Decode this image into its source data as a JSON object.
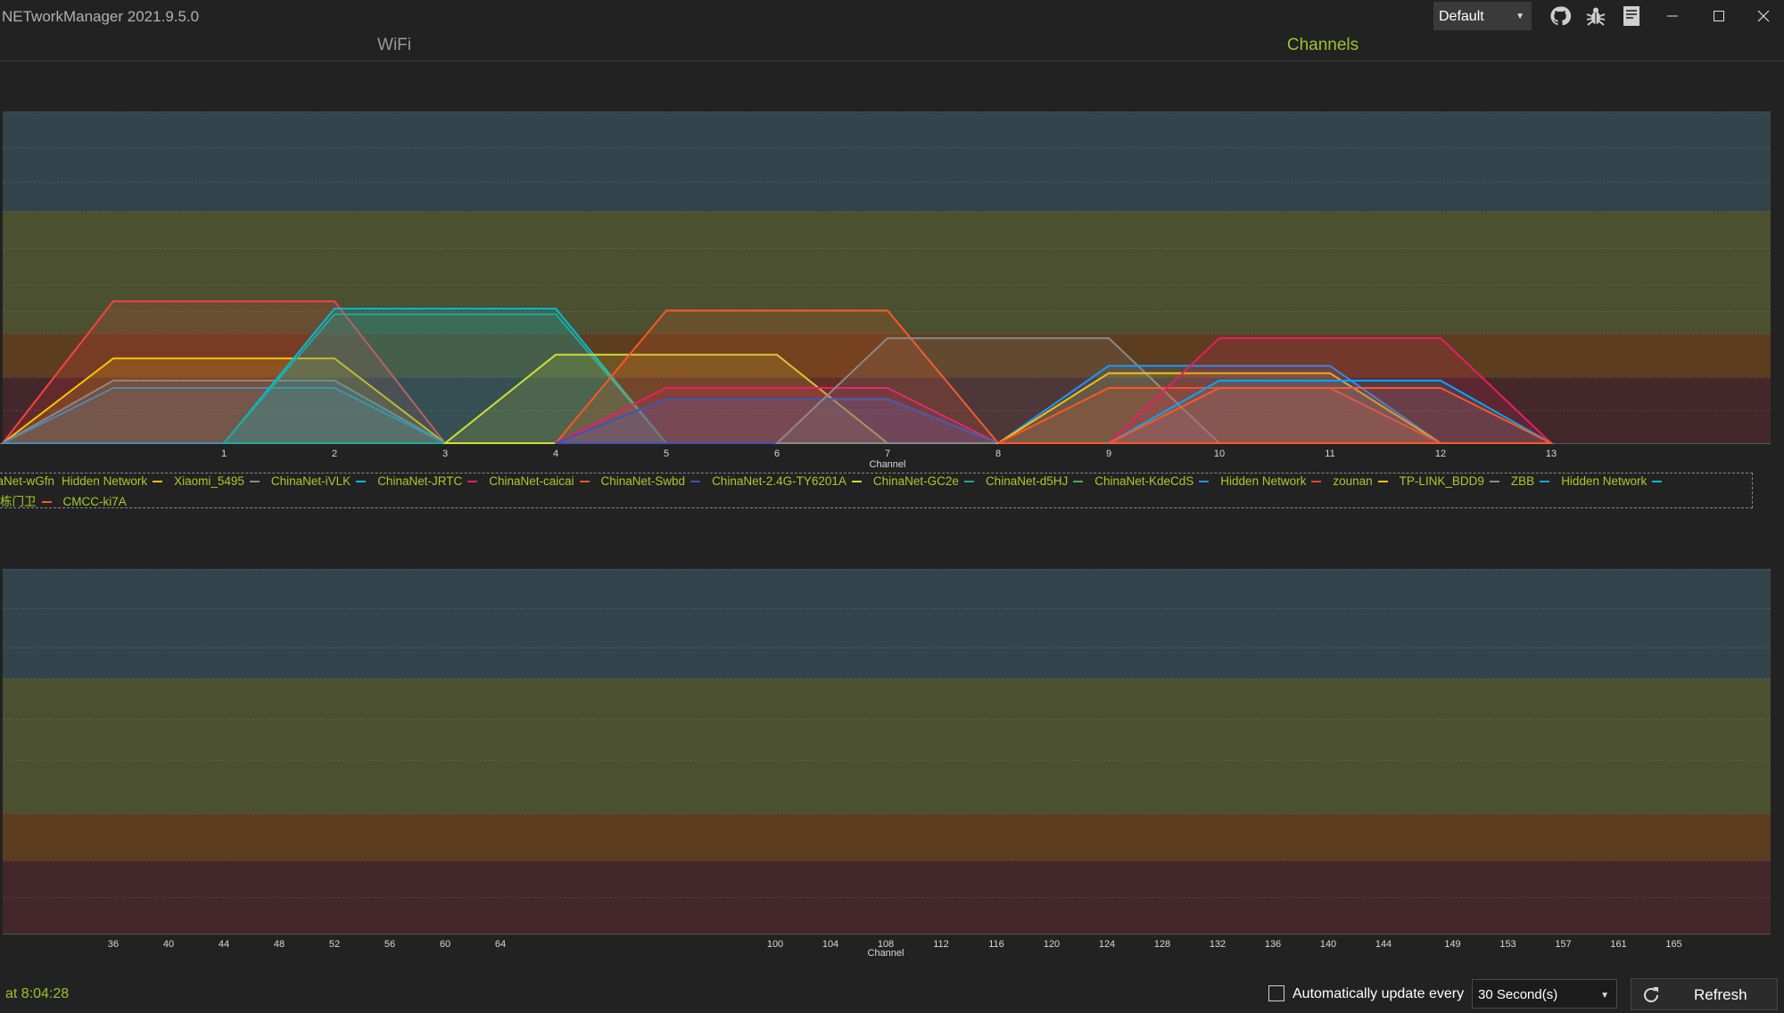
{
  "app": {
    "title": "NETworkManager 2021.9.5.0"
  },
  "titlebar": {
    "theme_selected": "Default",
    "icons": [
      "github-icon",
      "bug-icon",
      "document-icon"
    ],
    "window_controls": [
      "minimize-icon",
      "maximize-icon",
      "close-icon"
    ]
  },
  "tabs": [
    {
      "label": "WiFi",
      "active": false
    },
    {
      "label": "Channels",
      "active": true
    }
  ],
  "colors": {
    "accent": "#9cc130",
    "band_blue": "#33444d",
    "band_olive": "#4b5030",
    "band_orange": "#5c3d20",
    "band_red": "#44272a"
  },
  "legend": {
    "row1": [
      {
        "label": "inaNet-wGfn",
        "color": "#ff4040"
      },
      {
        "label": "Hidden Network",
        "color": "#ffc107"
      },
      {
        "label": "Xiaomi_5495",
        "color": "#8a8a8a"
      },
      {
        "label": "ChinaNet-iVLK",
        "color": "#00bcd4"
      },
      {
        "label": "ChinaNet-JRTC",
        "color": "#e91e63"
      },
      {
        "label": "ChinaNet-caicai",
        "color": "#ff5722"
      },
      {
        "label": "ChinaNet-Swbd",
        "color": "#3f51b5"
      },
      {
        "label": "ChinaNet-2.4G-TY6201A",
        "color": "#cddc39"
      },
      {
        "label": "ChinaNet-GC2e",
        "color": "#26a69a"
      },
      {
        "label": "ChinaNet-d5HJ",
        "color": "#4caf50"
      },
      {
        "label": "ChinaNet-KdeCdS",
        "color": "#2196f3"
      },
      {
        "label": "Hidden Network",
        "color": "#f44336"
      },
      {
        "label": "zounan",
        "color": "#ffc107"
      },
      {
        "label": "TP-LINK_BDD9",
        "color": "#8a8a8a"
      },
      {
        "label": "ZBB",
        "color": "#03a9f4"
      },
      {
        "label": "Hidden Network",
        "color": "#00bcd4"
      }
    ],
    "row2": [
      {
        "label": "栋门卫",
        "color": "#ff5722"
      },
      {
        "label": "CMCC-ki7A",
        "color": ""
      }
    ]
  },
  "chart_data": [
    {
      "type": "area",
      "title": "",
      "xlabel": "Channel",
      "ylabel": "",
      "x_ticks": [
        "1",
        "2",
        "3",
        "4",
        "5",
        "6",
        "7",
        "8",
        "9",
        "10",
        "11",
        "12",
        "13"
      ],
      "ylim": [
        -100,
        -10
      ],
      "grid": true,
      "legend_position": "bottom",
      "bands": [
        {
          "from": -10,
          "to": -37,
          "color": "#33444d"
        },
        {
          "from": -37,
          "to": -70,
          "color": "#4b5030"
        },
        {
          "from": -70,
          "to": -82,
          "color": "#5c3d20"
        },
        {
          "from": -82,
          "to": -100,
          "color": "#44272a"
        }
      ],
      "series": [
        {
          "color": "#ff4040",
          "x_start": -1,
          "x_end": 3,
          "y_value": -61.5
        },
        {
          "color": "#ffc107",
          "x_start": -1,
          "x_end": 3,
          "y_value": -77
        },
        {
          "color": "#8a8a8a",
          "x_start": -1,
          "x_end": 3,
          "y_value": -83
        },
        {
          "color": "#4a8ab8",
          "x_start": -1,
          "x_end": 3,
          "y_value": -85
        },
        {
          "color": "#00bcd4",
          "x_start": 1,
          "x_end": 5,
          "y_value": -63.5
        },
        {
          "color": "#26a69a",
          "x_start": 1,
          "x_end": 5,
          "y_value": -65
        },
        {
          "color": "#cddc39",
          "x_start": 3,
          "x_end": 7,
          "y_value": -76
        },
        {
          "color": "#4a8ab8",
          "x_start": 4,
          "x_end": 8,
          "y_value": -88
        },
        {
          "color": "#ff5722",
          "x_start": 4,
          "x_end": 8,
          "y_value": -64
        },
        {
          "color": "#e91e63",
          "x_start": 4,
          "x_end": 8,
          "y_value": -85
        },
        {
          "color": "#3f51b5",
          "x_start": 4,
          "x_end": 8,
          "y_value": -88
        },
        {
          "color": "#8a8a8a",
          "x_start": 6,
          "x_end": 10,
          "y_value": -71.5
        },
        {
          "color": "#2196f3",
          "x_start": 8,
          "x_end": 12,
          "y_value": -79
        },
        {
          "color": "#ffc107",
          "x_start": 8,
          "x_end": 12,
          "y_value": -81
        },
        {
          "color": "#ff5722",
          "x_start": 8,
          "x_end": 12,
          "y_value": -85
        },
        {
          "color": "#e91e63",
          "x_start": 9,
          "x_end": 13,
          "y_value": -71.5
        },
        {
          "color": "#03a9f4",
          "x_start": 9,
          "x_end": 13,
          "y_value": -83
        },
        {
          "color": "#ff5722",
          "x_start": 9,
          "x_end": 13,
          "y_value": -85
        }
      ]
    },
    {
      "type": "area",
      "title": "",
      "xlabel": "Channel",
      "ylabel": "",
      "x_ticks": [
        "36",
        "40",
        "44",
        "48",
        "52",
        "56",
        "60",
        "64",
        "100",
        "104",
        "108",
        "112",
        "116",
        "120",
        "124",
        "128",
        "132",
        "136",
        "140",
        "144",
        "149",
        "153",
        "157",
        "161",
        "165"
      ],
      "ylim": [
        -100,
        -10
      ],
      "grid": true,
      "bands": [
        {
          "from": -10,
          "to": -37,
          "color": "#33444d"
        },
        {
          "from": -37,
          "to": -70,
          "color": "#4b5030"
        },
        {
          "from": -70,
          "to": -82,
          "color": "#5c3d20"
        },
        {
          "from": -82,
          "to": -100,
          "color": "#44272a"
        }
      ],
      "series": []
    }
  ],
  "status": {
    "last_scan": "at 8:04:28",
    "auto_update_label": "Automatically update every",
    "auto_update_checked": false,
    "interval_value": "30 Second(s)",
    "refresh_label": "Refresh"
  }
}
